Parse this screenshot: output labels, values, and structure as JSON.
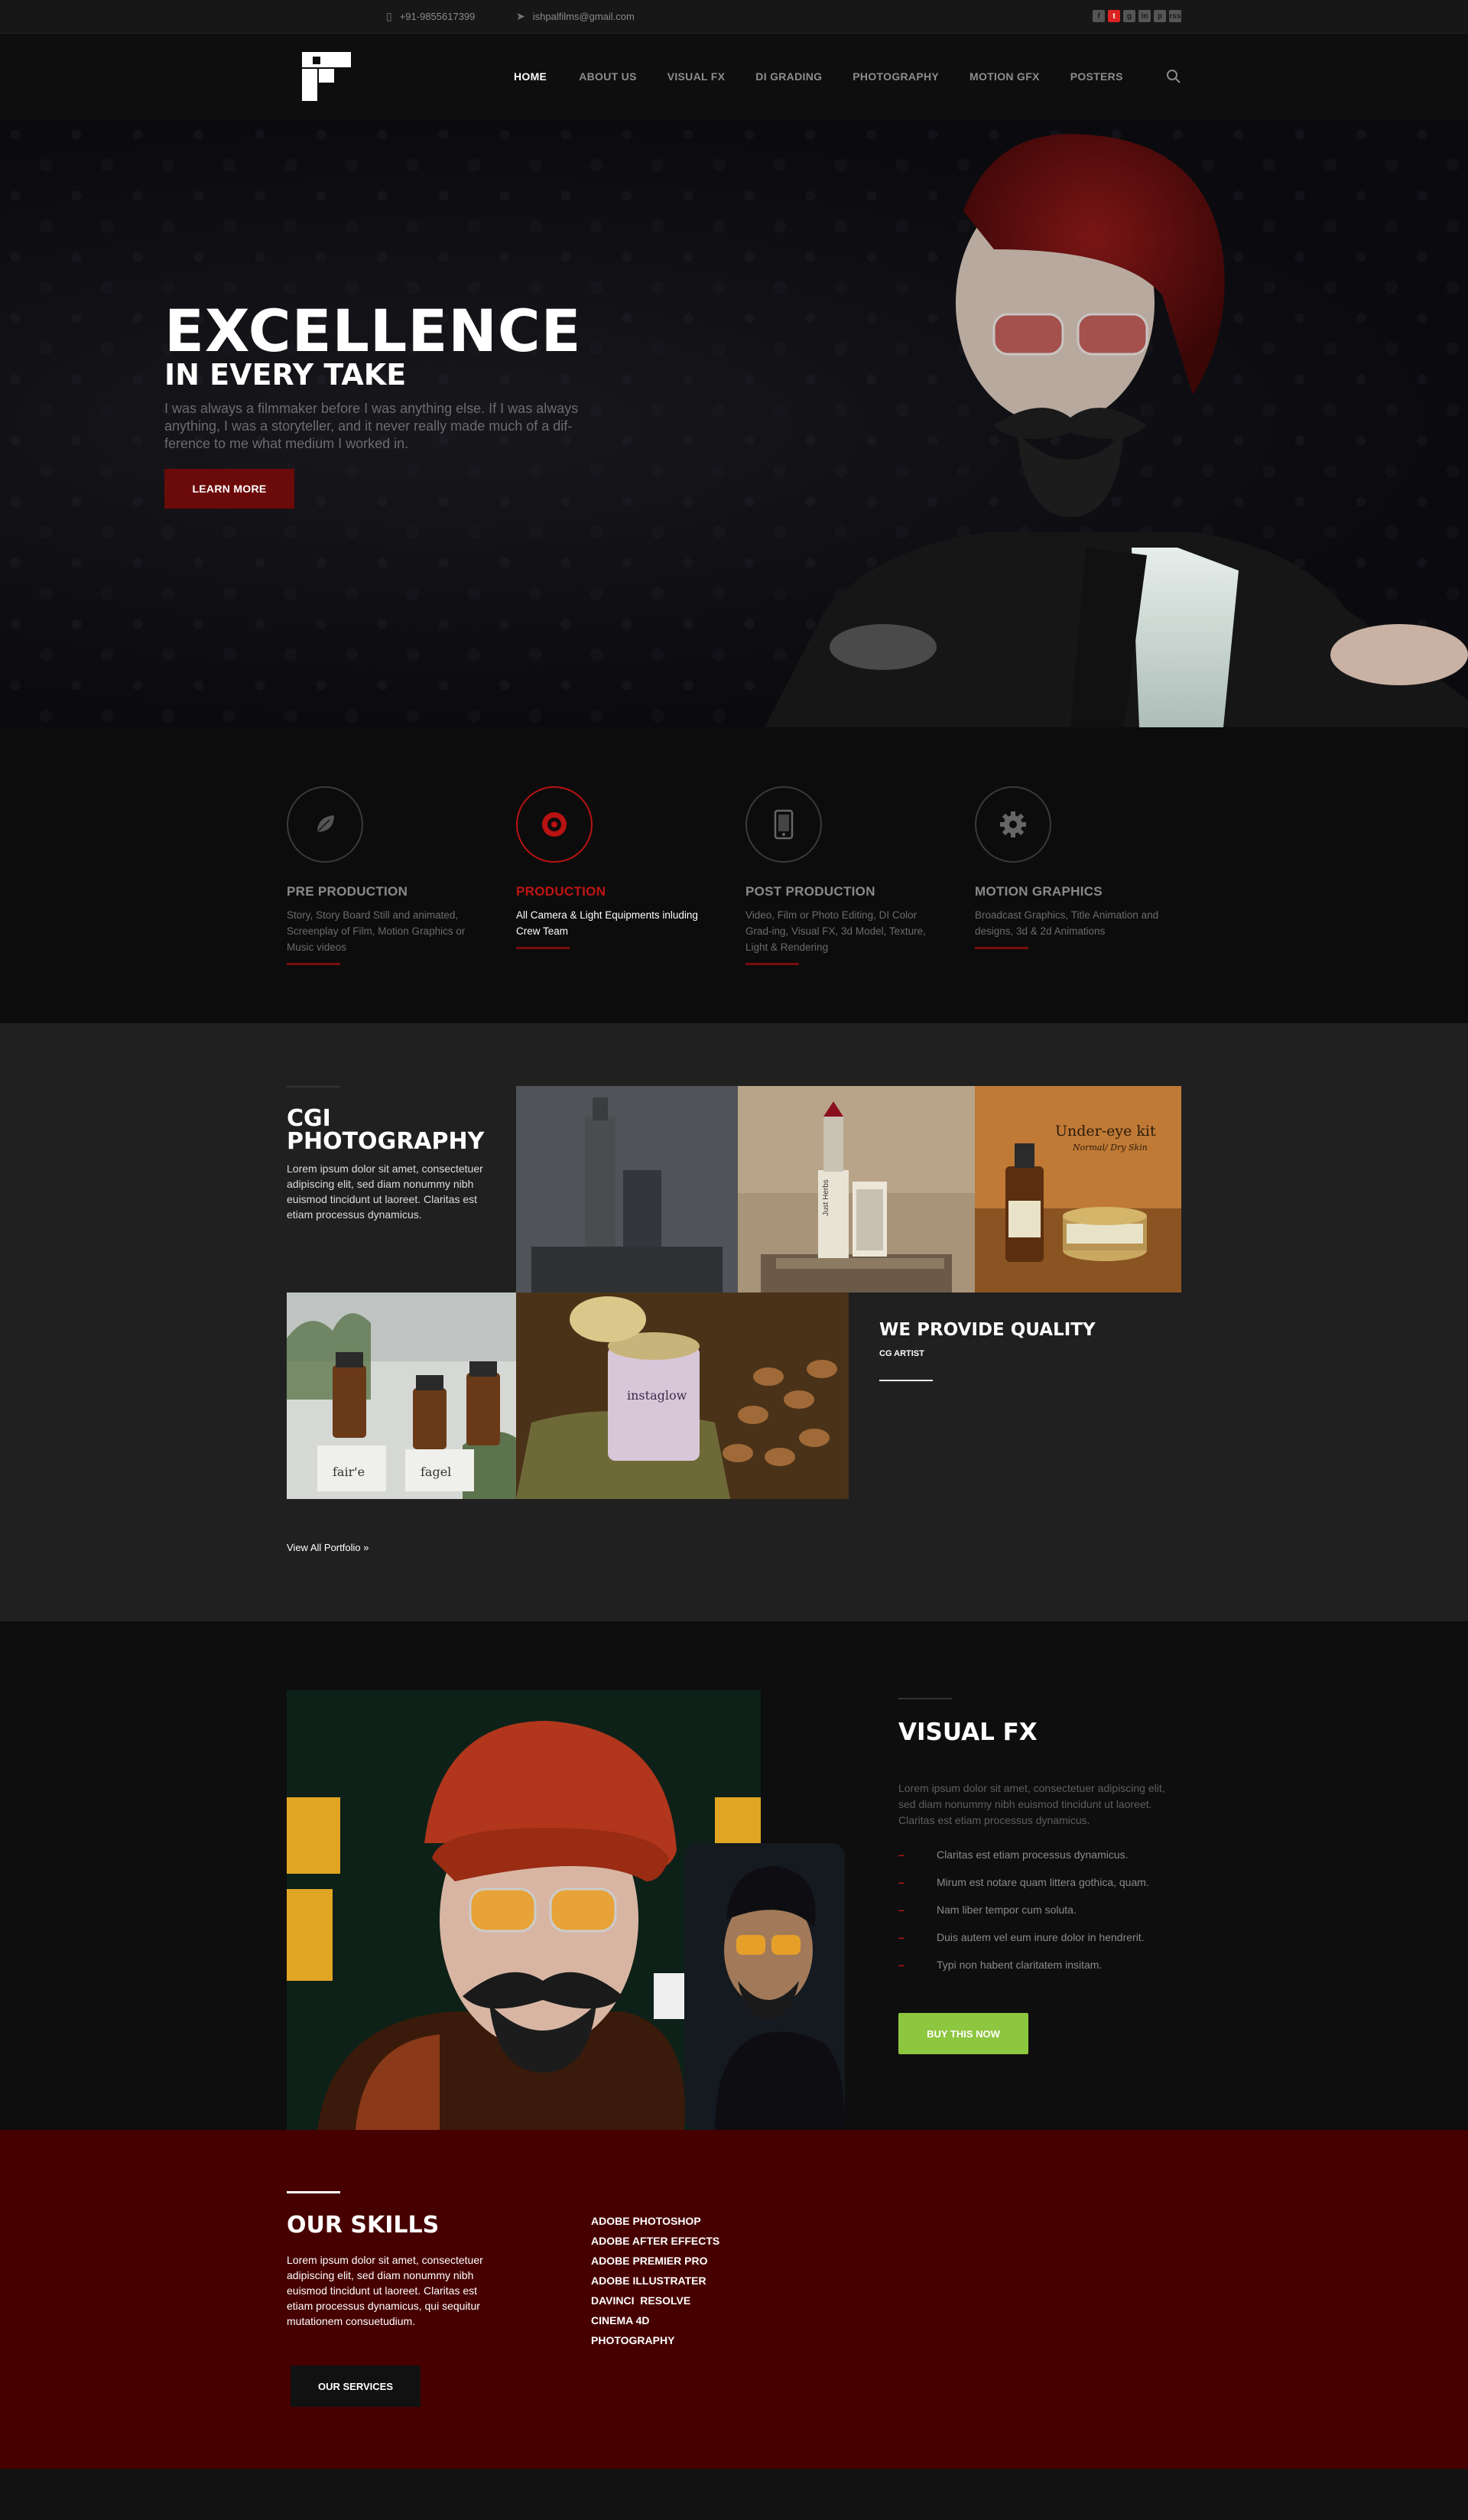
{
  "topbar": {
    "phone": "+91-9855617399",
    "email": "ishpalfilms@gmail.com",
    "social": [
      "f",
      "t",
      "g",
      "in",
      "p",
      "rss"
    ]
  },
  "nav": {
    "items": [
      "HOME",
      "ABOUT US",
      "VISUAL FX",
      "DI GRADING",
      "PHOTOGRAPHY",
      "MOTION GFX",
      "POSTERS"
    ],
    "active": "HOME"
  },
  "hero": {
    "title": "EXCELLENCE",
    "subtitle": "IN EVERY TAKE",
    "text": "I was always a filmmaker before I was anything else. If I was always anything, I was a storyteller, and it never really made much of a dif-ference to me what medium I worked in.",
    "button": "LEARN MORE"
  },
  "services": [
    {
      "title": "PRE PRODUCTION",
      "text": "Story, Story Board Still and animated, Screenplay of Film, Motion Graphics or Music videos",
      "icon": "leaf-icon"
    },
    {
      "title": "PRODUCTION",
      "text": "All Camera & Light Equipments inluding Crew Team",
      "icon": "camera-lens-icon"
    },
    {
      "title": "POST PRODUCTION",
      "text": "Video, Film or Photo Editing, DI Color Grad-ing, Visual FX, 3d Model, Texture, Light & Rendering",
      "icon": "mobile-icon"
    },
    {
      "title": "MOTION GRAPHICS",
      "text": "Broadcast Graphics, Title Animation and designs, 3d & 2d Animations",
      "icon": "gear-icon"
    }
  ],
  "cgi": {
    "title_line1": "CGI",
    "title_line2": "PHOTOGRAPHY",
    "text": "Lorem ipsum dolor sit amet, consectetuer adipiscing elit, sed diam nonummy nibh euismod tincidunt ut laoreet. Claritas est etiam processus dynamicus.",
    "quality_title": "WE PROVIDE QUALITY",
    "quality_sub": "CG ARTIST",
    "view_all": "View All Portfolio »",
    "product_labels": [
      "Under-eye kit",
      "Normal/ Dry Skin",
      "Just Herbs",
      "instaglow",
      "fair'e",
      "fagel"
    ]
  },
  "vfx": {
    "title": "VISUAL FX",
    "text": "Lorem ipsum dolor sit amet, consectetuer adipiscing elit, sed diam nonummy nibh euismod tincidunt ut laoreet. Claritas est etiam processus dynamicus.",
    "items": [
      "Claritas est etiam processus dynamicus.",
      "Mirum est notare quam littera gothica, quam.",
      "Nam liber tempor cum soluta.",
      "Duis autem vel eum inure dolor in hendrerit.",
      "Typi non habent claritatem insitam."
    ],
    "button": "BUY THIS NOW"
  },
  "skills": {
    "title": "OUR SKILLS",
    "text": "Lorem ipsum dolor sit amet, consectetuer adipiscing elit, sed diam nonummy nibh euismod tincidunt ut laoreet. Claritas est etiam processus dynamicus, qui sequitur mutationem consuetudium.",
    "list": [
      "ADOBE PHOTOSHOP",
      "ADOBE AFTER EFFECTS",
      "ADOBE PREMIER PRO",
      "ADOBE ILLUSTRATER",
      "DAVINCI  RESOLVE",
      "CINEMA 4D",
      "PHOTOGRAPHY"
    ],
    "button": "OUR SERVICES"
  },
  "colors": {
    "accent_red": "#c01414",
    "deep_red": "#470000",
    "button_red": "#6b0a0a",
    "green": "#8dc63f"
  }
}
